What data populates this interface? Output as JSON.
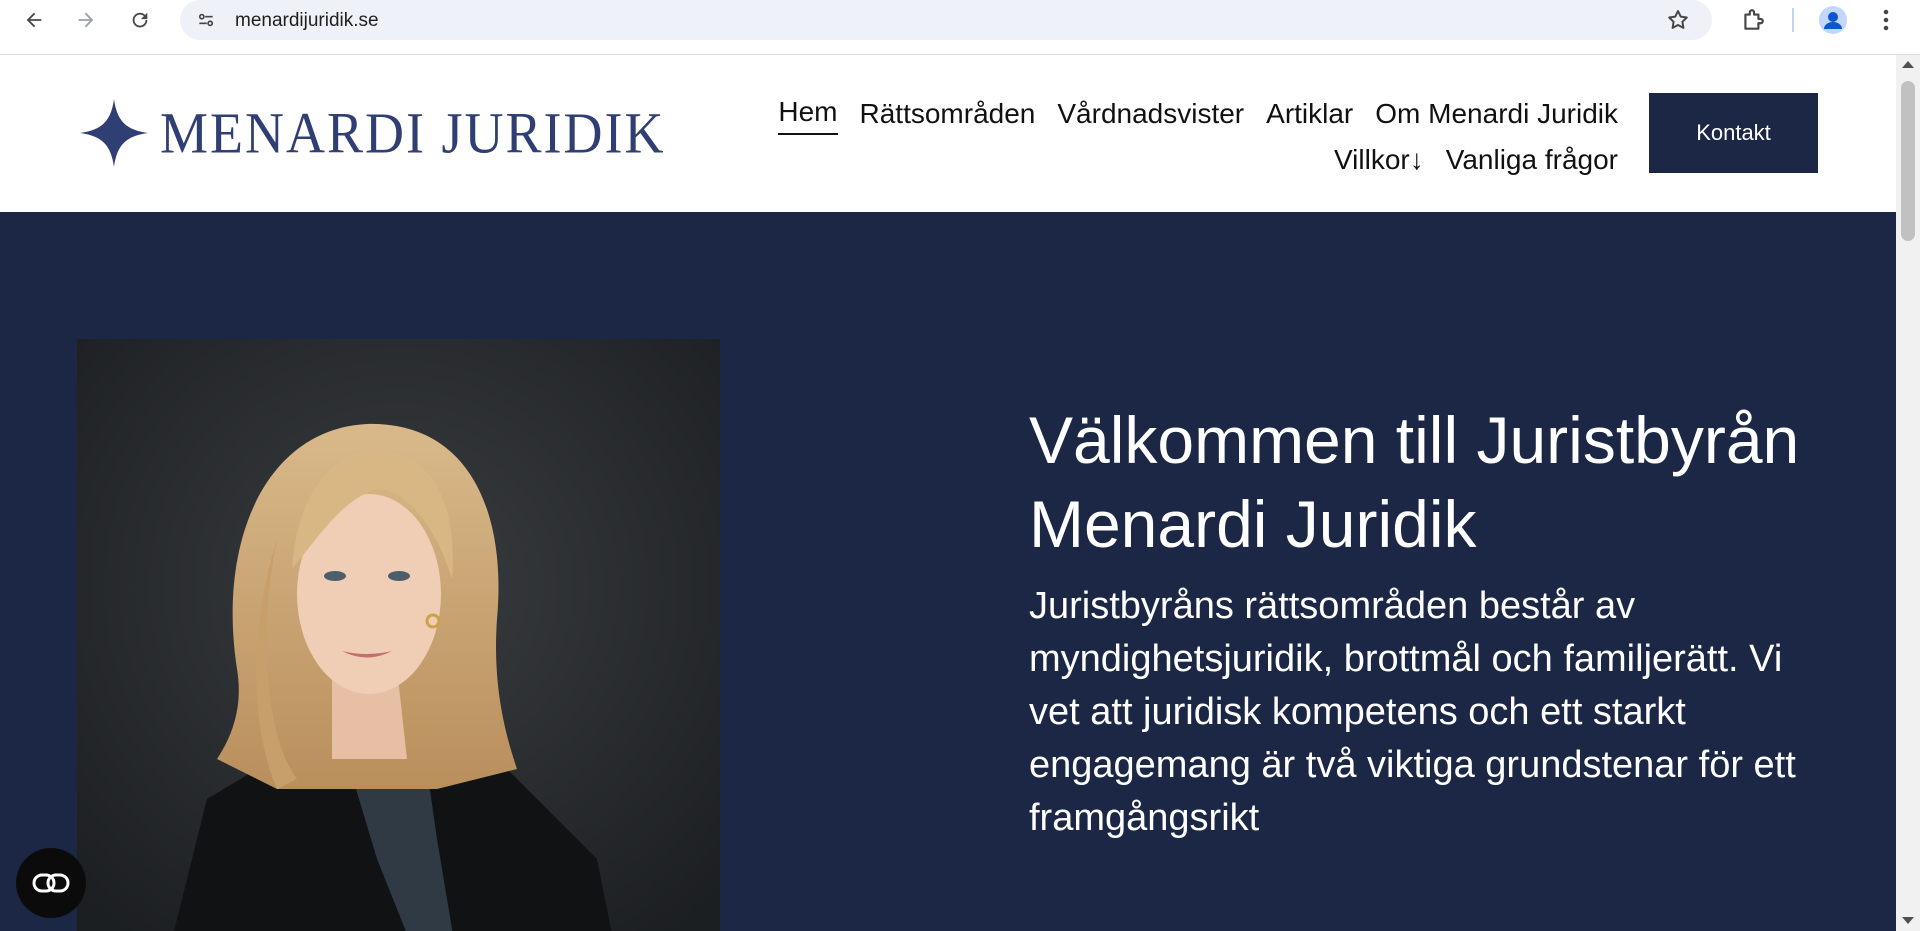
{
  "browser": {
    "url": "menardijuridik.se",
    "icons": [
      "back-arrow-icon",
      "forward-arrow-icon",
      "reload-icon",
      "site-info-icon",
      "bookmark-star-icon",
      "extensions-icon",
      "profile-icon",
      "menu-kebab-icon"
    ]
  },
  "header": {
    "logo_text": "MENARDI JURIDIK",
    "nav_row1": [
      "Hem",
      "Rättsområden",
      "Vårdnadsvister",
      "Artiklar",
      "Om Menardi Juridik"
    ],
    "nav_row2": [
      "Villkor↓",
      "Vanliga frågor"
    ],
    "contact_label": "Kontakt"
  },
  "hero": {
    "title": "Välkommen till Juristbyrån Menardi Juridik",
    "subtitle": "Juristbyråns rättsområden består av myndighetsjuridik, brottmål och familjerätt. Vi vet att juridisk kompetens och ett starkt engagemang är två viktiga grundstenar för ett framgångsrikt"
  },
  "colors": {
    "brand_navy": "#1b2744",
    "logo_blue": "#2f3f73"
  }
}
